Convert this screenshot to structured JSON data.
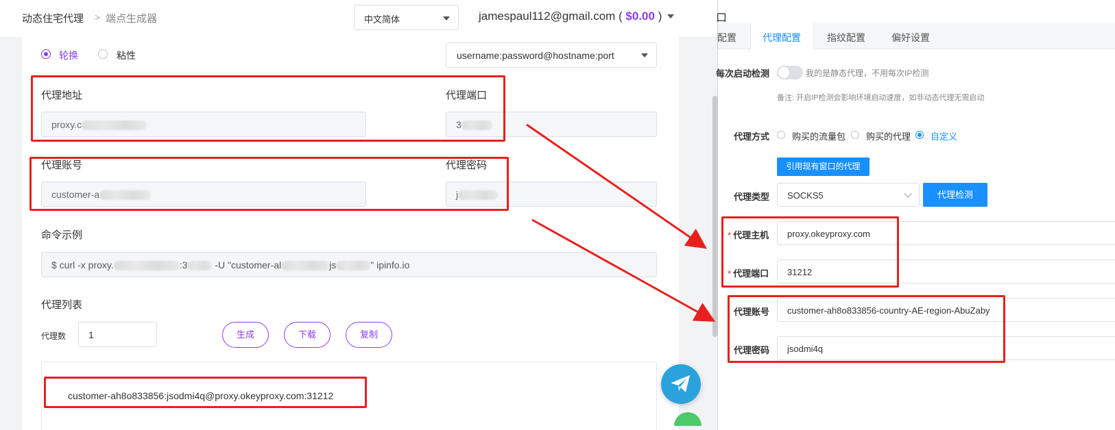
{
  "breadcrumb": {
    "root": "动态住宅代理",
    "separator": ">",
    "current": "端点生成器"
  },
  "language": {
    "selected": "中文简体"
  },
  "user": {
    "email": "jamespaul112@gmail.com",
    "balance_open": " ( ",
    "balance": "$0.00",
    "balance_close": " )"
  },
  "mode": {
    "rotate": "轮换",
    "sticky": "粘性",
    "selected": "rotate"
  },
  "format": {
    "selected": "username:password@hostname:port"
  },
  "fields": {
    "address_label": "代理地址",
    "address_value": "proxy.c",
    "port_label": "代理端口",
    "port_value": "3",
    "account_label": "代理账号",
    "account_value": "customer-a",
    "password_label": "代理密码",
    "password_value": "j"
  },
  "command": {
    "label": "命令示例",
    "part1": "$ curl -x proxy.",
    "part2": ":3",
    "part3": " -U \"customer-al",
    "part4": "js",
    "part5": "\" ipinfo.io"
  },
  "proxy_list": {
    "label": "代理列表",
    "count_label": "代理数",
    "count_value": "1",
    "generate": "生成",
    "download": "下载",
    "copy": "复制",
    "output": "customer-ah8o833856:jsodmi4q@proxy.okeyproxy.com:31212"
  },
  "right": {
    "title_fragment": "口",
    "tabs": [
      "配置",
      "代理配置",
      "指纹配置",
      "偏好设置"
    ],
    "active_tab": 1,
    "startup_check_label": "每次启动检测",
    "startup_check_text": "我的是静态代理，不用每次IP检测",
    "startup_check_note": "备注: 开启IP检测会影响环境启动速度，如非动态代理无需启动",
    "method_label": "代理方式",
    "methods": [
      "购买的流量包",
      "购买的代理",
      "自定义"
    ],
    "method_selected": 2,
    "use_existing_button": "引用现有窗口的代理",
    "type_label": "代理类型",
    "type_value": "SOCKS5",
    "check_button": "代理检测",
    "host_label": "代理主机",
    "host_value": "proxy.okeyproxy.com",
    "port_label": "代理端口",
    "port_value": "31212",
    "account_label": "代理账号",
    "account_value": "customer-ah8o833856-country-AE-region-AbuZaby",
    "password_label": "代理密码",
    "password_value": "jsodmi4q",
    "required_mark": "*"
  },
  "colors": {
    "accent_purple": "#8a3ff0",
    "accent_blue": "#1890ff",
    "annotation_red": "#e8201d",
    "telegram": "#2aa3dd"
  },
  "icons": {
    "telegram": "paper-plane-icon"
  }
}
